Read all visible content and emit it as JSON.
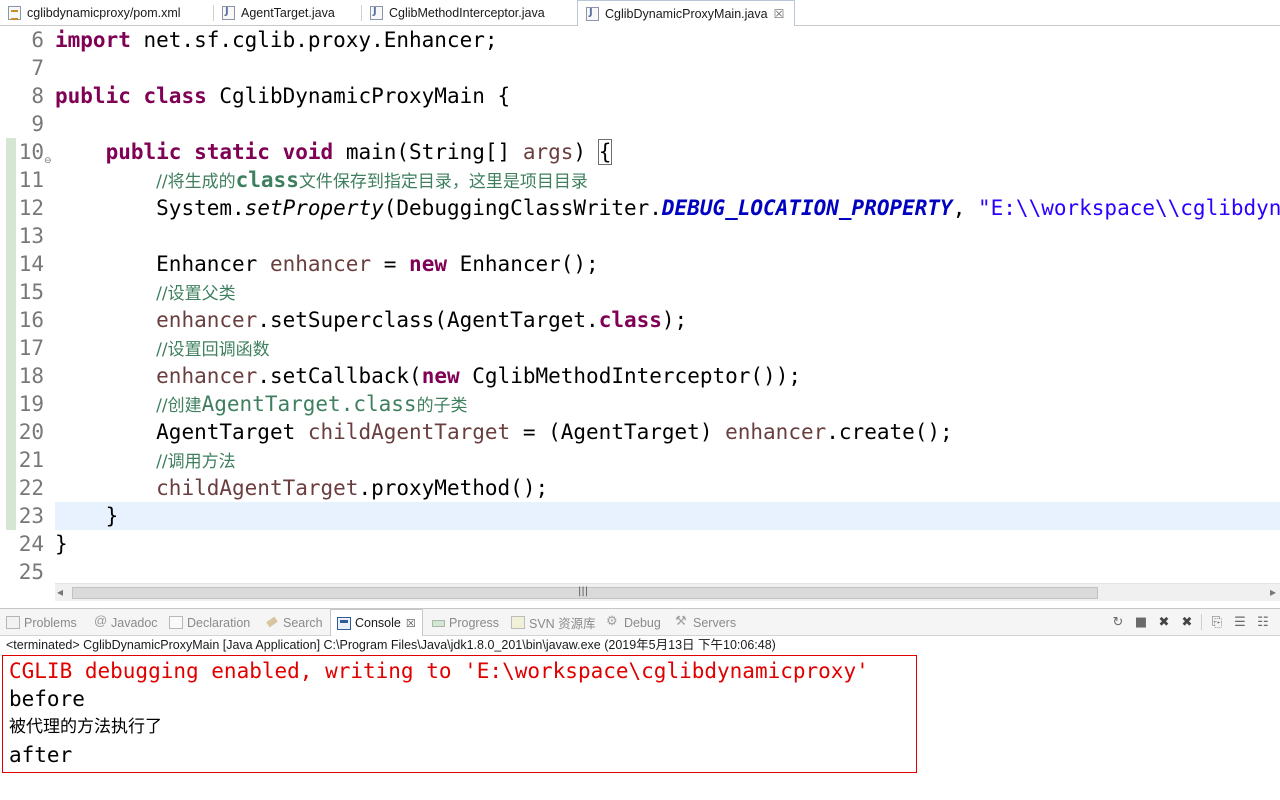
{
  "editor_tabs": [
    {
      "label": "cglibdynamicproxy/pom.xml",
      "icon": "xml-file-icon"
    },
    {
      "label": "AgentTarget.java",
      "icon": "java-file-icon"
    },
    {
      "label": "CglibMethodInterceptor.java",
      "icon": "java-file-icon"
    },
    {
      "label": "CglibDynamicProxyMain.java",
      "icon": "java-file-icon",
      "active": true,
      "close": "☒"
    }
  ],
  "code": {
    "line_numbers": [
      "6",
      "7",
      "8",
      "9",
      "10",
      "11",
      "12",
      "13",
      "14",
      "15",
      "16",
      "17",
      "18",
      "19",
      "20",
      "21",
      "22",
      "23",
      "24",
      "25"
    ],
    "l6": {
      "kw": "import",
      "rest": " net.sf.cglib.proxy.Enhancer;"
    },
    "l8": {
      "kw1": "public",
      "kw2": "class",
      "rest": " CglibDynamicProxyMain {"
    },
    "l10": {
      "kw1": "public",
      "kw2": "static",
      "kw3": "void",
      "mid": " main(String[] ",
      "arg": "args",
      "close": ") ",
      "brace": "{"
    },
    "l11": {
      "pre": "//将生成的",
      "bold": "class",
      "post": "文件保存到指定目录，这里是项目目录"
    },
    "l12": {
      "a": "System.",
      "b": "setProperty",
      "c": "(DebuggingClassWriter.",
      "d": "DEBUG_LOCATION_PROPERTY",
      "e": ", ",
      "f": "\"E:\\\\workspace\\\\cglibdynamicproxy\");"
    },
    "l14": {
      "a": "Enhancer ",
      "b": "enhancer",
      "c": " = ",
      "d": "new",
      "e": " Enhancer();"
    },
    "l15": {
      "text": "//设置父类"
    },
    "l16": {
      "a": "enhancer",
      "b": ".setSuperclass(AgentTarget.",
      "c": "class",
      "d": ");"
    },
    "l17": {
      "text": "//设置回调函数"
    },
    "l18": {
      "a": "enhancer",
      "b": ".setCallback(",
      "c": "new",
      "d": " CglibMethodInterceptor());"
    },
    "l19": {
      "pre": "//创建",
      "bold": "AgentTarget.class",
      "post": "的子类"
    },
    "l20": {
      "a": "AgentTarget ",
      "b": "childAgentTarget",
      "c": " = (AgentTarget) ",
      "d": "enhancer",
      "e": ".create();"
    },
    "l21": {
      "text": "//调用方法"
    },
    "l22": {
      "a": "childAgentTarget",
      "b": ".proxyMethod();"
    },
    "l23": {
      "text": "}"
    },
    "l24": {
      "text": "}"
    }
  },
  "scrollbar": {
    "left": "◂",
    "right": "▸",
    "grip": "|||"
  },
  "view_tabs": [
    {
      "label": "Problems",
      "icon": "problems-icon"
    },
    {
      "label": "Javadoc",
      "icon": "javadoc-icon"
    },
    {
      "label": "Declaration",
      "icon": "declaration-icon"
    },
    {
      "label": "Search",
      "icon": "search-icon"
    },
    {
      "label": "Console",
      "icon": "console-icon",
      "active": true,
      "close": "☒"
    },
    {
      "label": "Progress",
      "icon": "progress-icon"
    },
    {
      "label": "SVN 资源库",
      "icon": "svn-icon"
    },
    {
      "label": "Debug",
      "icon": "debug-icon"
    },
    {
      "label": "Servers",
      "icon": "servers-icon"
    }
  ],
  "toolbar_glyphs": {
    "pin": "↻",
    "stop": "■",
    "remove": "✖",
    "remove_all": "✖",
    "lock": "⎘",
    "scroll": "☰",
    "word": "☷"
  },
  "console": {
    "terminated": "<terminated> CglibDynamicProxyMain [Java Application] C:\\Program Files\\Java\\jdk1.8.0_201\\bin\\javaw.exe (2019年5月13日 下午10:06:48)",
    "lines": [
      "CGLIB debugging enabled, writing to 'E:\\workspace\\cglibdynamicproxy'",
      "before",
      "被代理的方法执行了",
      "after"
    ]
  },
  "colors": {
    "keyword": "#7f0055",
    "comment": "#3f7f5f",
    "string": "#2a00ff",
    "field": "#0000c0",
    "local_var": "#6a3e3e",
    "error_text": "#e00000",
    "current_line": "#e8f2fe"
  }
}
